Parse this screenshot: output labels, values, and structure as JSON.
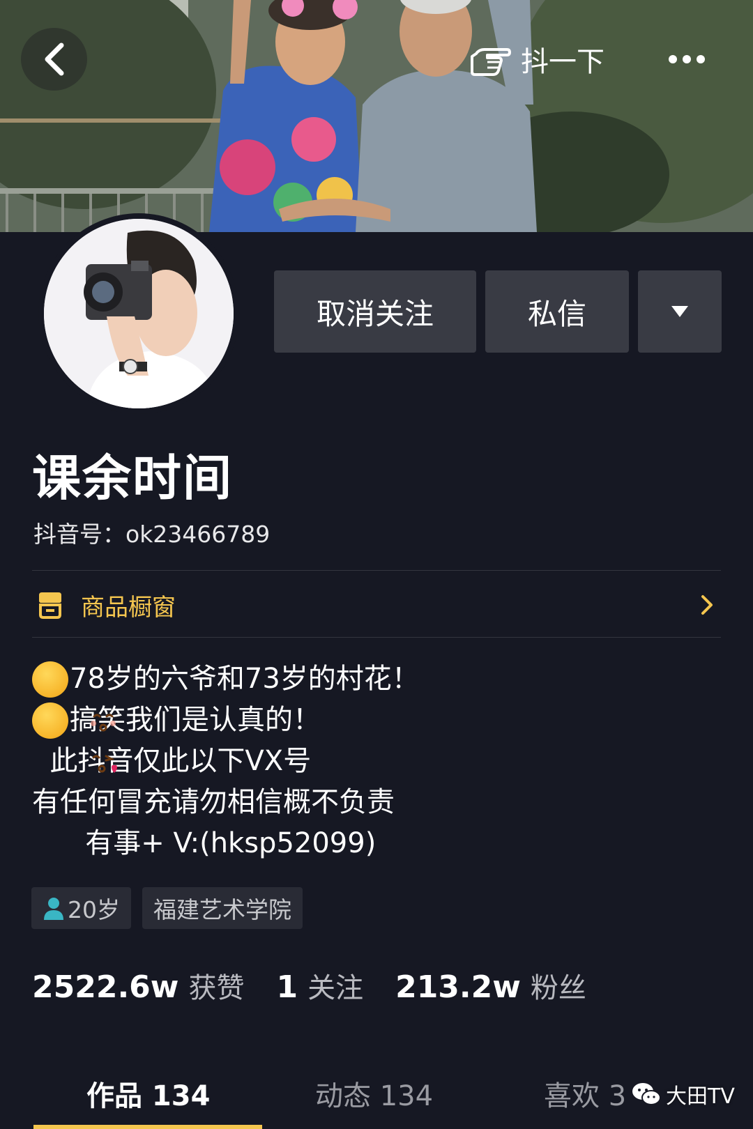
{
  "header": {
    "back_icon": "chevron-left-icon",
    "shake_label": "抖一下",
    "shake_icon": "pointing-hand-icon",
    "more_icon": "ellipsis-icon"
  },
  "actions": {
    "unfollow_label": "取消关注",
    "message_label": "私信",
    "more_icon": "caret-down-icon"
  },
  "profile": {
    "nickname": "课余时间",
    "douyin_id": "抖音号：ok23466789"
  },
  "shop": {
    "label": "商品橱窗",
    "icon": "shop-icon",
    "color": "#f5c64f"
  },
  "bio": {
    "line1": "78岁的六爷和73岁的村花！",
    "line2": "搞笑我们是认真的！",
    "line3": "  此抖音仅此以下VX号",
    "line4": "有任何冒充请勿相信概不负责",
    "line5": "      有事+ V:(hksp52099)"
  },
  "tags": {
    "age": "20岁",
    "school": "福建艺术学院"
  },
  "stats": {
    "likes_num": "2522.6w",
    "likes_label": "获赞",
    "following_num": "1",
    "following_label": "关注",
    "followers_num": "213.2w",
    "followers_label": "粉丝"
  },
  "tabs": {
    "works": "作品 134",
    "dynamics": "动态 134",
    "likes": "喜欢 3"
  },
  "watermark": {
    "text": "大田TV",
    "icon": "wechat-icon"
  },
  "colors": {
    "background": "#161823",
    "button": "#393b44",
    "accent": "#f5c64f"
  }
}
